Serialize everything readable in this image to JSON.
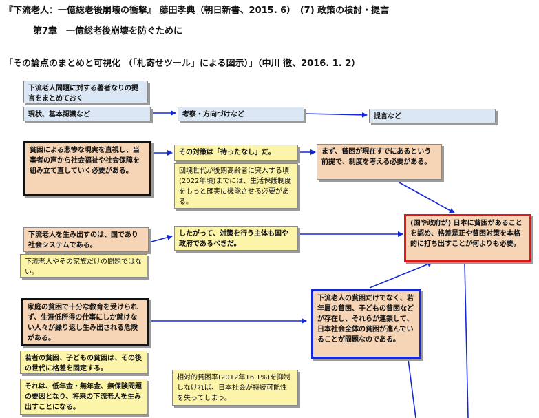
{
  "header": {
    "title": "『下流老人：一億総老後崩壊の衝撃』 藤田孝典（朝日新書、2015. 6）　(7) 政策の検討・提言",
    "chapter": "第7章　一億総老後崩壊を防ぐために",
    "subtitle": "「その論点のまとめと可視化 （「札寄せツール」による図示）」（中川 徹、2016. 1. 2）"
  },
  "diagram": {
    "top_note": "下流老人問題に対する著者なりの提言をまとめておく",
    "stage1": "現状、基本認識など",
    "stage2": "考察・方向づけなど",
    "stage3": "提言など",
    "c1": "貧困による悲惨な現実を直視し、当事者の声から社会福祉や社会保障を組み立て直していく必要がある。",
    "c2": "その対策は「待ったなし」だ。",
    "c3": "団塊世代が後期高齢者に突入する頃(2022年頃)までには、生活保護制度をもっと確実に機能させる必要がある。",
    "c4": "まず、貧困が現在すでにあるという前提で、制度を考える必要がある。",
    "c5": "(国や政府が) 日本に貧困があることを認め、格差是正や貧困対策を本格的に打ち出すことが何よりも必要。",
    "c6": "下流老人を生み出すのは、国であり社会システムである。",
    "c7": "下流老人やその家族だけの問題ではない。",
    "c8": "したがって、対策を行う主体も国や政府であるべきだ。",
    "c9": "家庭の貧困で十分な教育を受けられず、生涯低所得の仕事にしか就けない人々が繰り返し生み出される危険がある。",
    "c10": "若者の貧困、子どもの貧困は、その後の世代に格差を固定する。",
    "c11": "それは、低年金・無年金、無保険問題の要因となり、将来の下流老人を生み出すことになる。",
    "c12": "相対的貧困率(2012年16.1%)を抑制しなければ、日本社会が持続可能性を失ってしまう。",
    "c13": "下流老人の貧困だけでなく、若年層の貧困、子どもの貧困などが存在し、それらが連鎖して、日本社会全体の貧困が進んでいることが問題なのである。"
  },
  "colors": {
    "arrow": "#1428d8",
    "highlight_red": "#e0161b",
    "highlight_blue": "#1428d8",
    "note_yellow": "#fcf4a8",
    "card_salmon": "#f6d5b7",
    "card_blue": "#dbe7f4"
  }
}
